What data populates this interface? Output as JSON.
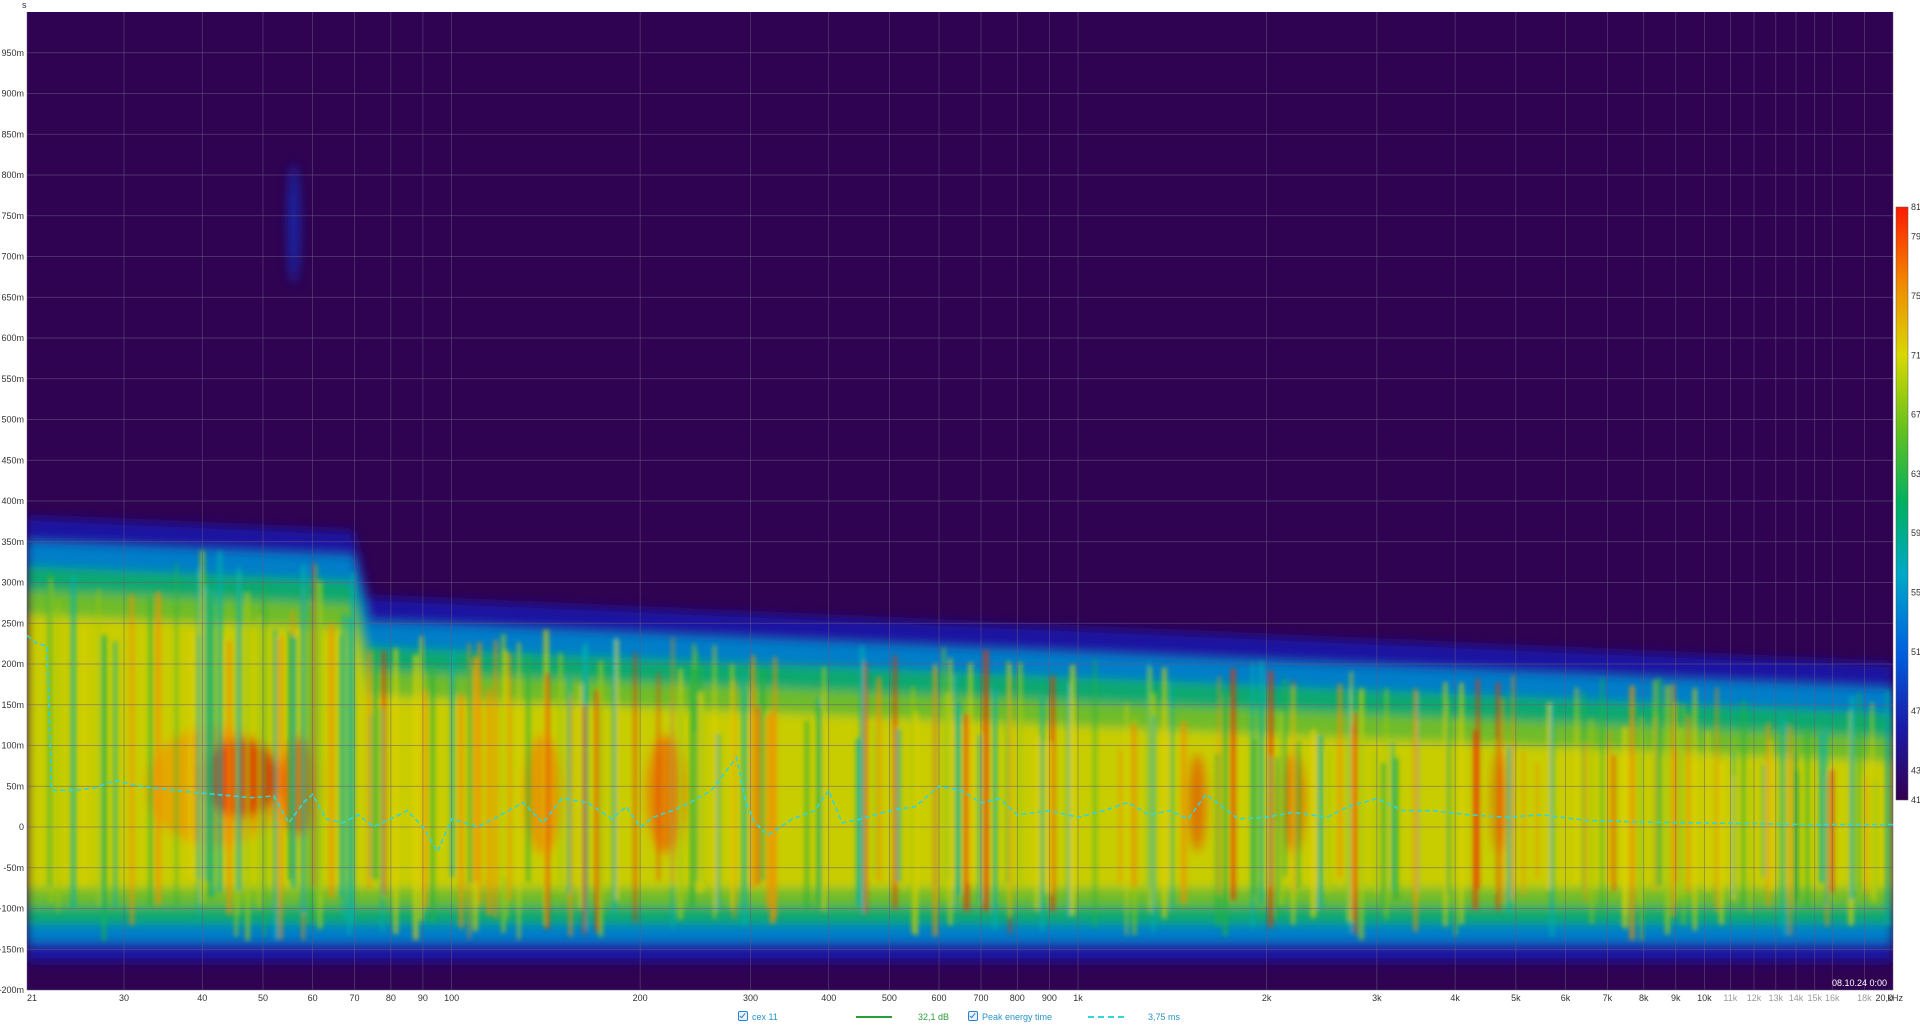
{
  "chart_data": {
    "type": "heatmap",
    "title": "",
    "xlabel": "kHz",
    "ylabel": "s",
    "x_scale": "log",
    "xlim": [
      21,
      20000
    ],
    "ylim": [
      -0.2,
      1.0
    ],
    "x_ticks": [
      {
        "label": "21",
        "value": 21
      },
      {
        "label": "30",
        "value": 30
      },
      {
        "label": "40",
        "value": 40
      },
      {
        "label": "50",
        "value": 50
      },
      {
        "label": "60",
        "value": 60
      },
      {
        "label": "70",
        "value": 70
      },
      {
        "label": "80",
        "value": 80
      },
      {
        "label": "90",
        "value": 90
      },
      {
        "label": "100",
        "value": 100
      },
      {
        "label": "200",
        "value": 200
      },
      {
        "label": "300",
        "value": 300
      },
      {
        "label": "400",
        "value": 400
      },
      {
        "label": "500",
        "value": 500
      },
      {
        "label": "600",
        "value": 600
      },
      {
        "label": "700",
        "value": 700
      },
      {
        "label": "800",
        "value": 800
      },
      {
        "label": "900",
        "value": 900
      },
      {
        "label": "1k",
        "value": 1000
      },
      {
        "label": "2k",
        "value": 2000
      },
      {
        "label": "3k",
        "value": 3000
      },
      {
        "label": "4k",
        "value": 4000
      },
      {
        "label": "5k",
        "value": 5000
      },
      {
        "label": "6k",
        "value": 6000
      },
      {
        "label": "7k",
        "value": 7000
      },
      {
        "label": "8k",
        "value": 8000
      },
      {
        "label": "9k",
        "value": 9000
      },
      {
        "label": "10k",
        "value": 10000
      },
      {
        "label": "11k",
        "value": 11000,
        "faint": true
      },
      {
        "label": "12k",
        "value": 12000,
        "faint": true
      },
      {
        "label": "13k",
        "value": 13000,
        "faint": true
      },
      {
        "label": "14k",
        "value": 14000,
        "faint": true
      },
      {
        "label": "15k",
        "value": 15000,
        "faint": true
      },
      {
        "label": "16k",
        "value": 16000,
        "faint": true
      },
      {
        "label": "18k",
        "value": 18000,
        "faint": true
      },
      {
        "label": "20,0",
        "value": 20000
      }
    ],
    "y_ticks": [
      {
        "label": "950m",
        "value": 0.95
      },
      {
        "label": "900m",
        "value": 0.9
      },
      {
        "label": "850m",
        "value": 0.85
      },
      {
        "label": "800m",
        "value": 0.8
      },
      {
        "label": "750m",
        "value": 0.75
      },
      {
        "label": "700m",
        "value": 0.7
      },
      {
        "label": "650m",
        "value": 0.65
      },
      {
        "label": "600m",
        "value": 0.6
      },
      {
        "label": "550m",
        "value": 0.55
      },
      {
        "label": "500m",
        "value": 0.5
      },
      {
        "label": "450m",
        "value": 0.45
      },
      {
        "label": "400m",
        "value": 0.4
      },
      {
        "label": "350m",
        "value": 0.35
      },
      {
        "label": "300m",
        "value": 0.3
      },
      {
        "label": "250m",
        "value": 0.25
      },
      {
        "label": "200m",
        "value": 0.2
      },
      {
        "label": "150m",
        "value": 0.15
      },
      {
        "label": "100m",
        "value": 0.1
      },
      {
        "label": "50m",
        "value": 0.05
      },
      {
        "label": "0",
        "value": 0.0
      },
      {
        "label": "-50m",
        "value": -0.05
      },
      {
        "label": "-100m",
        "value": -0.1
      },
      {
        "label": "-150m",
        "value": -0.15
      },
      {
        "label": "-200m",
        "value": -0.2
      }
    ],
    "colorbar": {
      "min": 41,
      "max": 81,
      "ticks": [
        {
          "label": "81",
          "value": 81
        },
        {
          "label": "79",
          "value": 79
        },
        {
          "label": "75",
          "value": 75
        },
        {
          "label": "71",
          "value": 71
        },
        {
          "label": "67",
          "value": 67
        },
        {
          "label": "63",
          "value": 63
        },
        {
          "label": "59",
          "value": 59
        },
        {
          "label": "55",
          "value": 55
        },
        {
          "label": "51",
          "value": 51
        },
        {
          "label": "47",
          "value": 47
        },
        {
          "label": "43",
          "value": 43
        },
        {
          "label": "41",
          "value": 41
        }
      ]
    },
    "grid": true,
    "background_color": "#2f0352",
    "peak_energy_curve": {
      "name": "Peak energy time",
      "color": "#33d6d6",
      "style": "dashed",
      "points": [
        [
          21,
          0.235
        ],
        [
          21.8,
          0.225
        ],
        [
          22.6,
          0.222
        ],
        [
          23,
          0.045
        ],
        [
          25,
          0.045
        ],
        [
          27,
          0.048
        ],
        [
          29,
          0.057
        ],
        [
          32,
          0.05
        ],
        [
          36,
          0.045
        ],
        [
          42,
          0.04
        ],
        [
          48,
          0.036
        ],
        [
          52,
          0.038
        ],
        [
          55,
          0.005
        ],
        [
          58,
          0.03
        ],
        [
          60,
          0.04
        ],
        [
          63,
          0.01
        ],
        [
          67,
          0.005
        ],
        [
          71,
          0.015
        ],
        [
          75,
          0.0
        ],
        [
          80,
          0.01
        ],
        [
          85,
          0.02
        ],
        [
          90,
          0.0
        ],
        [
          95,
          -0.03
        ],
        [
          100,
          0.01
        ],
        [
          110,
          0.0
        ],
        [
          120,
          0.015
        ],
        [
          130,
          0.03
        ],
        [
          140,
          0.005
        ],
        [
          150,
          0.035
        ],
        [
          165,
          0.03
        ],
        [
          180,
          0.01
        ],
        [
          190,
          0.025
        ],
        [
          200,
          0.0
        ],
        [
          210,
          0.012
        ],
        [
          225,
          0.02
        ],
        [
          240,
          0.03
        ],
        [
          260,
          0.045
        ],
        [
          275,
          0.07
        ],
        [
          285,
          0.085
        ],
        [
          295,
          0.03
        ],
        [
          305,
          0.005
        ],
        [
          320,
          -0.01
        ],
        [
          350,
          0.01
        ],
        [
          380,
          0.02
        ],
        [
          400,
          0.045
        ],
        [
          420,
          0.005
        ],
        [
          450,
          0.01
        ],
        [
          500,
          0.02
        ],
        [
          550,
          0.025
        ],
        [
          600,
          0.05
        ],
        [
          650,
          0.045
        ],
        [
          700,
          0.03
        ],
        [
          750,
          0.035
        ],
        [
          800,
          0.015
        ],
        [
          900,
          0.02
        ],
        [
          1000,
          0.012
        ],
        [
          1100,
          0.02
        ],
        [
          1200,
          0.03
        ],
        [
          1300,
          0.015
        ],
        [
          1400,
          0.02
        ],
        [
          1500,
          0.01
        ],
        [
          1600,
          0.04
        ],
        [
          1700,
          0.025
        ],
        [
          1800,
          0.01
        ],
        [
          2000,
          0.012
        ],
        [
          2200,
          0.018
        ],
        [
          2500,
          0.012
        ],
        [
          2700,
          0.025
        ],
        [
          3000,
          0.035
        ],
        [
          3300,
          0.02
        ],
        [
          3700,
          0.02
        ],
        [
          4200,
          0.015
        ],
        [
          4800,
          0.012
        ],
        [
          5500,
          0.015
        ],
        [
          6500,
          0.008
        ],
        [
          8000,
          0.006
        ],
        [
          10000,
          0.005
        ],
        [
          12000,
          0.004
        ],
        [
          15000,
          0.003
        ],
        [
          18000,
          0.003
        ],
        [
          20000,
          0.003
        ]
      ]
    }
  },
  "timestamp": "08.10.24 0:00",
  "legend": {
    "items": [
      {
        "name": "cex 11",
        "value": "32,1 dB",
        "color": "#2a9d3a"
      },
      {
        "name": "Peak energy time",
        "value": "3,75 ms",
        "color": "#33d6d6"
      }
    ]
  }
}
